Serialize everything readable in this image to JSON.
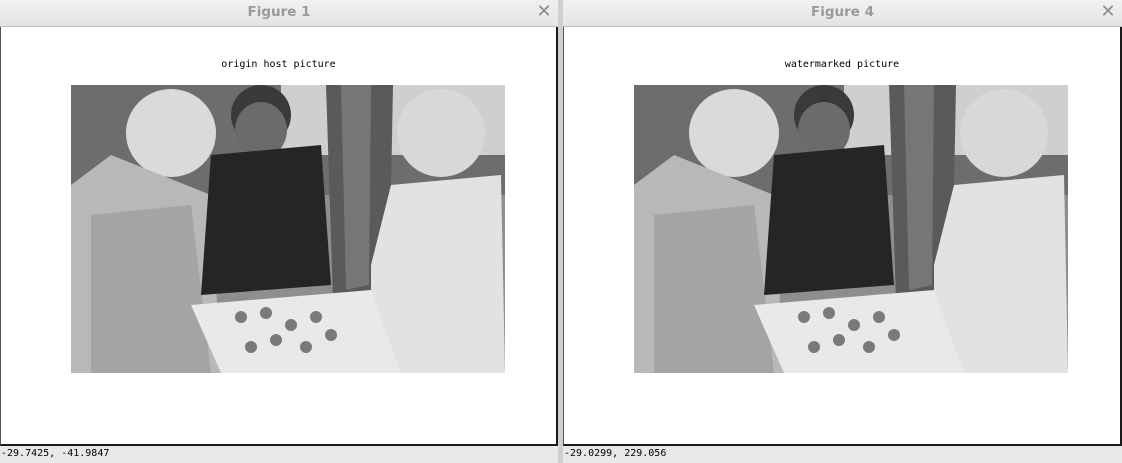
{
  "windows": [
    {
      "title": "Figure 1",
      "axes_title": "origin host picture",
      "coords": "-29.7425, -41.9847"
    },
    {
      "title": "Figure 4",
      "axes_title": "watermarked picture",
      "coords": "-29.0299,  229.056"
    }
  ],
  "close_glyph": "✕"
}
